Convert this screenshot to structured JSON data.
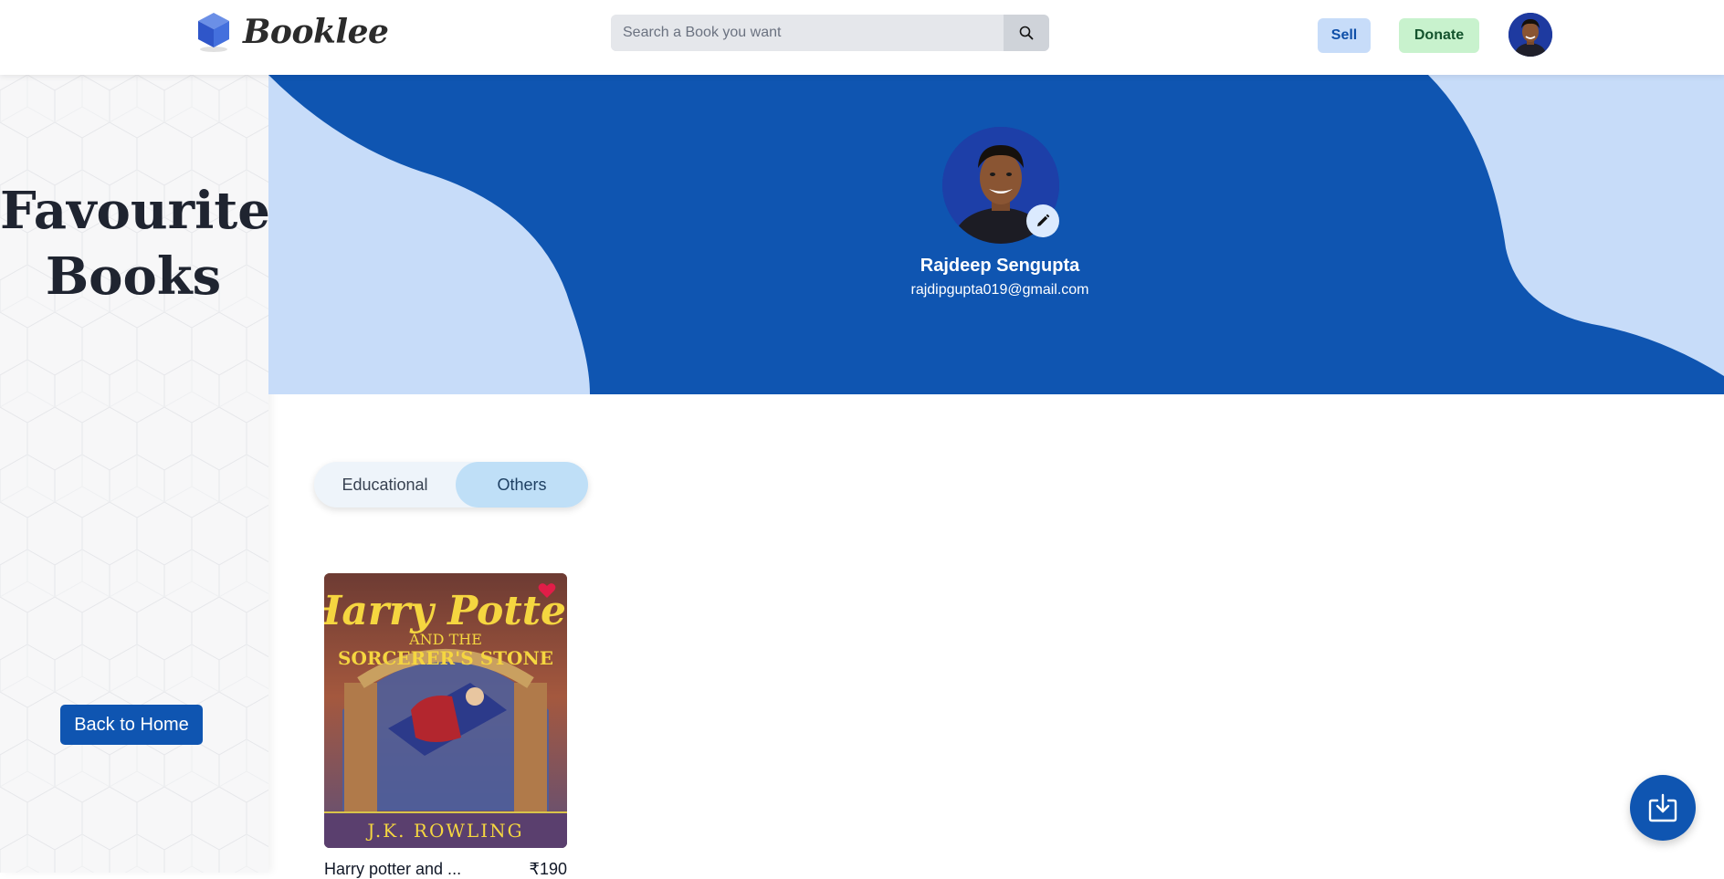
{
  "header": {
    "brand": "Booklee",
    "search_placeholder": "Search a Book you want",
    "sell_label": "Sell",
    "donate_label": "Donate"
  },
  "sidebar": {
    "title_line1": "Favourite",
    "title_line2": "Books",
    "back_label": "Back to Home"
  },
  "profile": {
    "name": "Rajdeep Sengupta",
    "email": "rajdipgupta019@gmail.com"
  },
  "tabs": [
    {
      "label": "Educational",
      "active": false
    },
    {
      "label": "Others",
      "active": true
    }
  ],
  "books": [
    {
      "title": "Harry potter and ...",
      "price": "₹190",
      "cover_title_1": "Harry Potter",
      "cover_title_2": "AND THE",
      "cover_title_3": "SORCERER'S STONE",
      "cover_author": "J.K. ROWLING",
      "favourite": true
    }
  ],
  "colors": {
    "banner_blue": "#0f55b1",
    "banner_light": "#c7dcf9",
    "accent": "#0f55b1",
    "heart": "#e11d48"
  },
  "icons": {
    "search": "search-icon",
    "edit": "pencil-icon",
    "fab": "download-tray-icon",
    "favourite": "heart-icon"
  }
}
